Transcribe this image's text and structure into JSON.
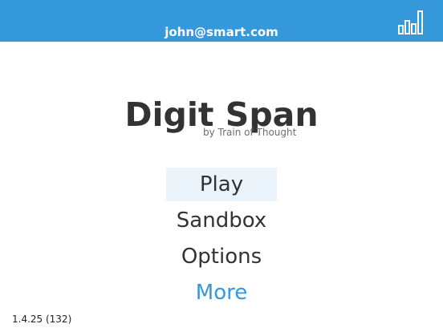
{
  "header": {
    "user_email": "john@smart.com",
    "stats_icon": "bar-chart-icon",
    "background_color": "#3498db"
  },
  "app": {
    "title": "Digit Span",
    "subtitle": "by Train of Thought"
  },
  "menu": {
    "items": [
      {
        "label": "Play",
        "state": "selected"
      },
      {
        "label": "Sandbox"
      },
      {
        "label": "Options"
      },
      {
        "label": "More",
        "color": "#3498db"
      }
    ]
  },
  "footer": {
    "version": "1.4.25 (132)"
  }
}
